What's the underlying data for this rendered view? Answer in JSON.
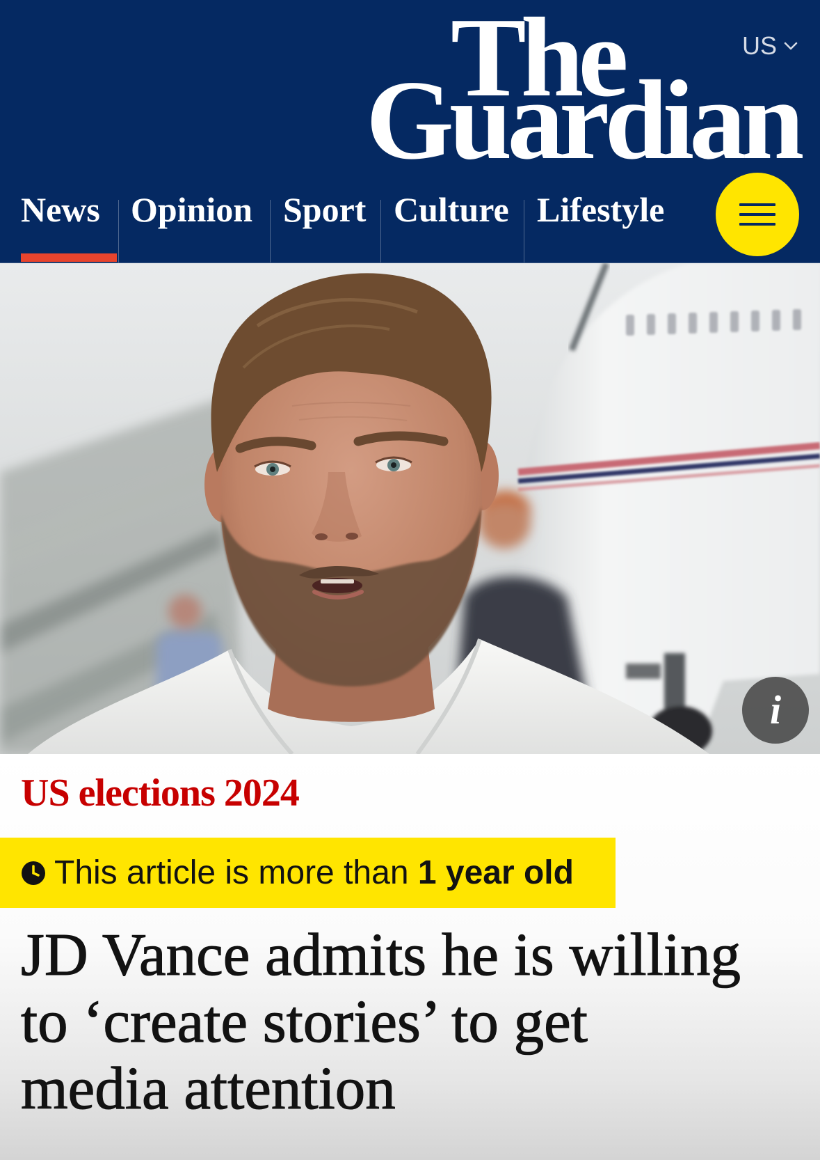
{
  "header": {
    "logo": {
      "line1": "The",
      "line2": "Guardian"
    },
    "edition": {
      "label": "US",
      "icon": "chevron-down-icon"
    }
  },
  "nav": {
    "items": [
      {
        "label": "News",
        "active": true
      },
      {
        "label": "Opinion",
        "active": false
      },
      {
        "label": "Sport",
        "active": false
      },
      {
        "label": "Culture",
        "active": false
      },
      {
        "label": "Lifestyle",
        "active": false
      }
    ],
    "menu_button": {
      "icon": "hamburger-menu-icon"
    }
  },
  "hero": {
    "info_button": {
      "icon": "info-icon",
      "glyph": "i"
    }
  },
  "article": {
    "series": "US elections 2024",
    "age_notice": {
      "icon": "clock-icon",
      "text": "This article is more than ",
      "emphasis": "1 year old"
    },
    "headline_lines": [
      "JD Vance admits he is willing",
      "to ‘create stories’ to get",
      "media attention"
    ]
  },
  "colors": {
    "brand_blue": "#052962",
    "highlight_yellow": "#ffe500",
    "series_red": "#c70000",
    "active_underline": "#e8442d",
    "headline_text": "#121212"
  }
}
